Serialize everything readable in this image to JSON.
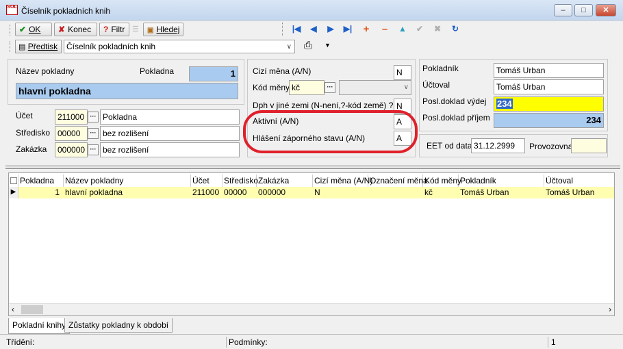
{
  "window": {
    "title": "Číselník pokladních knih",
    "logo_text": "SOL"
  },
  "toolbar": {
    "ok": "OK",
    "konec": "Konec",
    "filtr": "Filtr",
    "hledej": "Hledej",
    "nav_icons": [
      "first-icon",
      "prev-icon",
      "next-icon",
      "last-icon",
      "add-icon",
      "delete-icon",
      "up-icon",
      "confirm-icon",
      "cancel-icon",
      "refresh-icon"
    ],
    "predtisk": "Předtisk",
    "form_select": "Číselník pokladních knih"
  },
  "left_panel": {
    "nazev_label": "Název pokladny",
    "pokladna_label": "Pokladna",
    "pokladna_value": "1",
    "nazev_value": "hlavní pokladna",
    "ucet_label": "Účet",
    "ucet_code": "211000",
    "ucet_name": "Pokladna",
    "stredisko_label": "Středisko",
    "stredisko_code": "00000",
    "stredisko_name": "bez rozlišení",
    "zakazka_label": "Zakázka",
    "zakazka_code": "000000",
    "zakazka_name": "bez rozlišení"
  },
  "middle_panel": {
    "cizi_mena_label": "Cizí měna (A/N)",
    "cizi_mena_value": "N",
    "kod_meny_label": "Kód měny",
    "kod_meny_value": "kč",
    "dph_label": "Dph v jiné zemi (N-není,?-kód země) ?",
    "dph_value": "N",
    "aktivni_label": "Aktivní (A/N)",
    "aktivni_value": "A",
    "hlaseni_label": "Hlášení záporného stavu (A/N)",
    "hlaseni_value": "A"
  },
  "right_panel": {
    "pokladnik_label": "Pokladník",
    "pokladnik_value": "Tomáš Urban",
    "uctoval_label": "Účtoval",
    "uctoval_value": "Tomáš Urban",
    "posl_vydej_label": "Posl.doklad výdej",
    "posl_vydej_value": "234",
    "posl_prijem_label": "Posl.doklad příjem",
    "posl_prijem_value": "234",
    "eet_label": "EET od data",
    "eet_value": "31.12.2999",
    "provozovna_label": "Provozovna",
    "provozovna_value": ""
  },
  "grid": {
    "columns": [
      "Pokladna",
      "Název pokladny",
      "Účet",
      "Středisko",
      "Zakázka",
      "Cizí měna (A/N)",
      "Označení měna",
      "Kód měny",
      "Pokladník",
      "Účtoval"
    ],
    "rows": [
      [
        "1",
        "hlavní pokladna",
        "211000",
        "00000",
        "000000",
        "N",
        "",
        "kč",
        "Tomáš Urban",
        "Tomáš Urban"
      ]
    ]
  },
  "tabs": [
    "Pokladní knihy",
    "Zůstatky pokladny k období"
  ],
  "status": {
    "trideni": "Třídění:",
    "podminky": "Podmínky:",
    "count": "1"
  },
  "colors": {
    "highlight_red": "#e0202a",
    "selected_row": "#fffdb0",
    "blue_field": "#a9cbef",
    "yellow_field": "#ffff00"
  }
}
